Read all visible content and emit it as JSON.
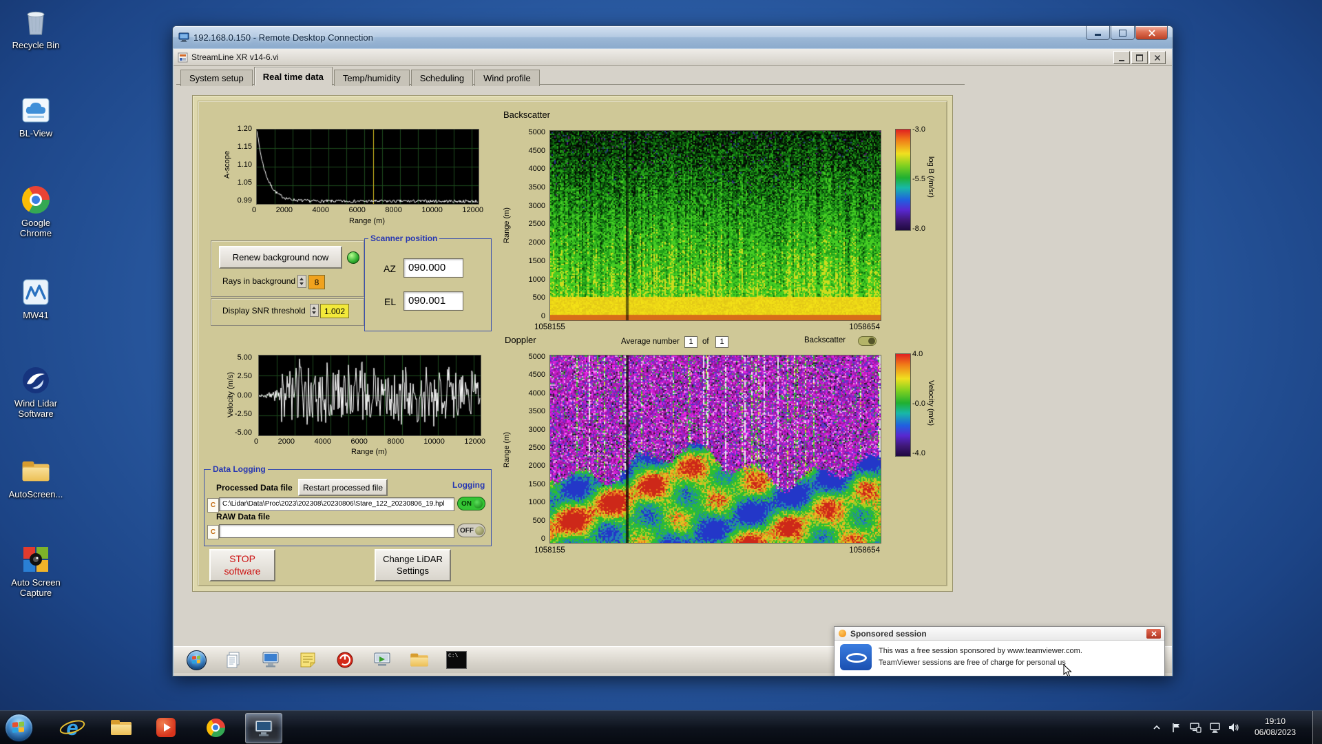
{
  "desktop": {
    "icons": [
      {
        "label": "Recycle Bin"
      },
      {
        "label": "BL-View"
      },
      {
        "label": "Google Chrome"
      },
      {
        "label": "MW41"
      },
      {
        "label": "Wind Lidar Software"
      },
      {
        "label": "AutoScreen..."
      },
      {
        "label": "Auto Screen Capture"
      }
    ]
  },
  "rdp": {
    "title": "192.168.0.150 - Remote Desktop Connection"
  },
  "app": {
    "title": "StreamLine XR v14-6.vi",
    "tabs": [
      "System setup",
      "Real time data",
      "Temp/humidity",
      "Scheduling",
      "Wind profile"
    ],
    "active_tab": "Real time data"
  },
  "panel": {
    "backscatter_title": "Backscatter",
    "doppler_title": "Doppler",
    "renew_button": "Renew background now",
    "rays_label": "Rays in background",
    "rays_value": "8",
    "snr_label": "Display SNR threshold",
    "snr_value": "1.002",
    "scanner": {
      "title": "Scanner position",
      "az_label": "AZ",
      "az_value": "090.000",
      "el_label": "EL",
      "el_value": "090.001"
    },
    "doppler_controls": {
      "average_label": "Average number",
      "avg_value": "1",
      "of_label": "of",
      "count_value": "1",
      "toggle_label": "Backscatter"
    },
    "logging": {
      "title": "Data Logging",
      "processed_label": "Processed Data file",
      "restart_button": "Restart processed file",
      "logging_label": "Logging",
      "drive": "C",
      "processed_path": "C:\\Lidar\\Data\\Proc\\2023\\202308\\20230806\\Stare_122_20230806_19.hpl",
      "on_label": "ON",
      "raw_label": "RAW Data file",
      "raw_path": "",
      "off_label": "OFF"
    },
    "stop_button_line1": "STOP",
    "stop_button_line2": "software",
    "change_button_line1": "Change LiDAR",
    "change_button_line2": "Settings"
  },
  "chart_data": [
    {
      "type": "line",
      "title": "A-scope",
      "xlabel": "Range (m)",
      "ylabel": "A-scope",
      "xticks": [
        "0",
        "2000",
        "4000",
        "6000",
        "8000",
        "10000",
        "12000"
      ],
      "yticks": [
        "1.20",
        "1.15",
        "1.10",
        "1.05",
        "0.99"
      ],
      "xlim": [
        0,
        12400
      ],
      "ylim": [
        0.99,
        1.2
      ],
      "description": "Background intensity decays from 1.20 at 0 m to ~1.00 noise floor beyond 2000 m; yellow cursor near 6500 m"
    },
    {
      "type": "line",
      "title": "Doppler velocity trace",
      "xlabel": "Range (m)",
      "ylabel": "Velocity (m/s)",
      "xticks": [
        "0",
        "2000",
        "4000",
        "6000",
        "8000",
        "10000",
        "12000"
      ],
      "yticks": [
        "5.00",
        "2.50",
        "0.00",
        "-2.50",
        "-5.00"
      ],
      "xlim": [
        0,
        12400
      ],
      "ylim": [
        -5,
        5
      ],
      "description": "Velocities near 0 m/s below ~1200 m, saturated noise spanning +/-5 m/s at farther ranges"
    },
    {
      "type": "heatmap",
      "title": "Backscatter",
      "ylabel": "Range (m)",
      "yticks": [
        "5000",
        "4500",
        "4000",
        "3500",
        "3000",
        "2500",
        "2000",
        "1500",
        "1000",
        "500",
        "0"
      ],
      "x_start": "1058155",
      "x_end": "1058654",
      "colorbar_label": "log B (/m/sr)",
      "colorbar_ticks": [
        "-3.0",
        "-5.5",
        "-8.0"
      ],
      "description": "Time-height backscatter: strong yellow-orange signal below ~600 m, speckled green noise above"
    },
    {
      "type": "heatmap",
      "title": "Doppler",
      "ylabel": "Range (m)",
      "yticks": [
        "5000",
        "4500",
        "4000",
        "3500",
        "3000",
        "2500",
        "2000",
        "1500",
        "1000",
        "500",
        "0"
      ],
      "x_start": "1058155",
      "x_end": "1058654",
      "colorbar_label": "Velocity (m/s)",
      "colorbar_ticks": [
        "4.0",
        "-0.0",
        "-4.0"
      ],
      "description": "Time-height velocity: coherent +/-4 m/s structure below ~2000 m, magenta noise aloft"
    }
  ],
  "popup": {
    "title": "Sponsored session",
    "line1": "This was a free session sponsored by www.teamviewer.com.",
    "line2": "TeamViewer sessions are free of charge for personal us"
  },
  "remote_taskbar": {
    "terminal_text": "C:\\"
  },
  "taskbar": {
    "ie_glyph": "e",
    "clock": {
      "time": "19:10",
      "date": "06/08/2023"
    }
  }
}
